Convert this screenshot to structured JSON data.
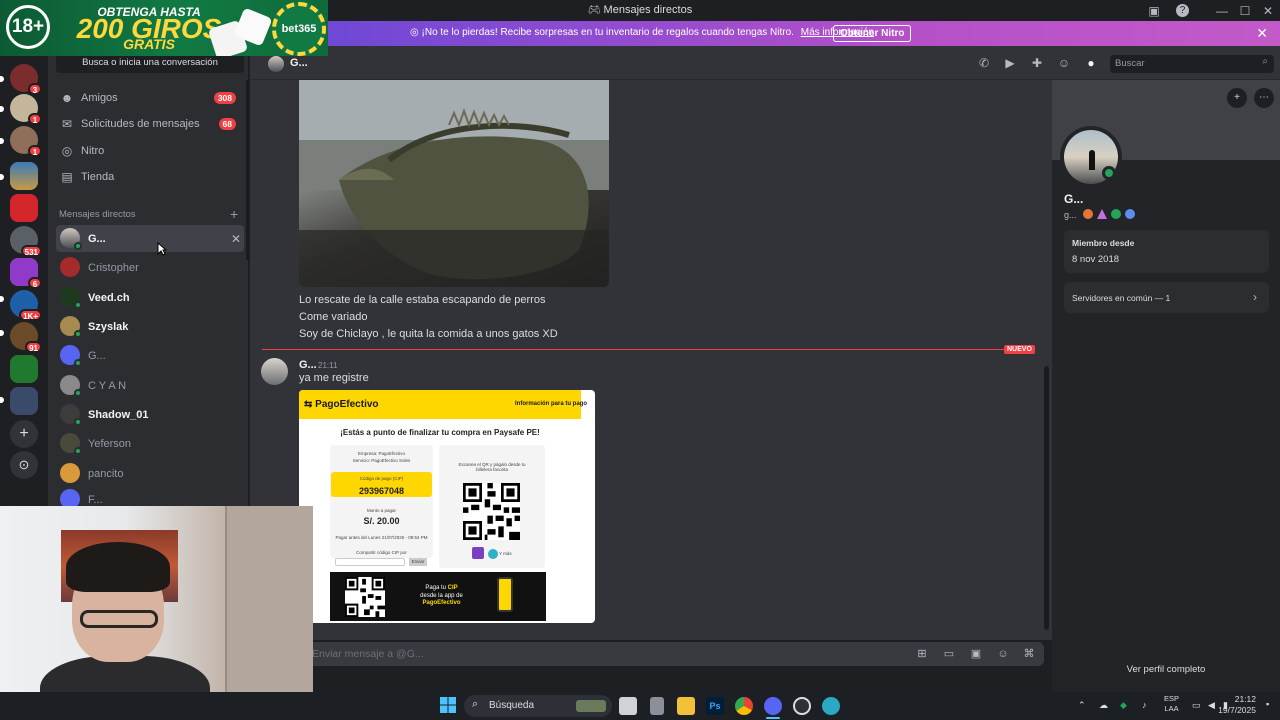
{
  "window": {
    "title": "Mensajes directos",
    "minimize": "—",
    "maximize": "☐",
    "close": "✕"
  },
  "ad": {
    "age": "18+",
    "line1": "OBTENGA HASTA",
    "line2": "200 GIROS",
    "line3": "GRATIS",
    "brand": "bet365"
  },
  "banner": {
    "text": "¡No te lo pierdas! Recibe sorpresas en tu inventario de regalos cuando tengas Nitro.",
    "link": "Más información",
    "cta": "Obtener Nitro",
    "close": "✕"
  },
  "rail": {
    "badges": [
      "3",
      "1",
      "1",
      "",
      "",
      "531",
      "6",
      "1K+",
      "91",
      "",
      ""
    ]
  },
  "sidebar": {
    "search_placeholder": "Busca o inicia una conversación",
    "nav": [
      {
        "label": "Amigos",
        "count": "308"
      },
      {
        "label": "Solicitudes de mensajes",
        "count": "68"
      },
      {
        "label": "Nitro",
        "count": ""
      },
      {
        "label": "Tienda",
        "count": ""
      }
    ],
    "dm_header": "Mensajes directos",
    "dm_add": "+",
    "dms": [
      {
        "name": "G...",
        "bold": true
      },
      {
        "name": "Cristopher",
        "bold": false
      },
      {
        "name": "Veed.ch",
        "bold": true
      },
      {
        "name": "Szyslak",
        "bold": true
      },
      {
        "name": "G...",
        "bold": false
      },
      {
        "name": "C Y A N",
        "bold": false
      },
      {
        "name": "Shadow_01",
        "bold": true
      },
      {
        "name": "Yeferson",
        "bold": false
      },
      {
        "name": "pancito",
        "bold": false
      },
      {
        "name": "F...",
        "bold": false
      }
    ],
    "dm_close": "✕"
  },
  "chat": {
    "header_name": "G...",
    "search_placeholder": "Buscar",
    "messages_prev": [
      "Lo rescate de la calle estaba escapando de perros",
      "Come variado",
      "Soy de Chiclayo , le quita la comida a unos gatos XD"
    ],
    "new_label": "NUEVO",
    "author": "G...",
    "time": "21:11",
    "message": "ya me registre",
    "input_placeholder": "Enviar mensaje a @G..."
  },
  "receipt": {
    "brand": "PagoEfectivo",
    "info": "Información para tu pago",
    "heading": "¡Estás a punto de finalizar tu compra en Paysafe PE!",
    "company": "Empresa: PagoEfectivo",
    "service": "Servicio: PagoEfectivo Soles",
    "cip_label": "Código de pago (CIP)",
    "cip": "293967048",
    "amount_label": "Monto a pagar",
    "amount": "S/. 20.00",
    "due": "Pagar antes del Lunes 21/07/2025 - 08:54 PM",
    "share": "Compartir código CIP por",
    "send": "Enviar",
    "scan_text": "Escanea el QR y págalo desde tu billetera favorita",
    "yape": "Y más",
    "bottom_line1": "Paga tu",
    "bottom_cip": "CIP",
    "bottom_line2": "desde la app de",
    "bottom_brand": "PagoEfectivo"
  },
  "profile": {
    "name": "G...",
    "username": "g...",
    "member_since_label": "Miembro desde",
    "member_since": "8 nov 2018",
    "common_servers": "Servidores en común — 1",
    "full_profile": "Ver perfil completo"
  },
  "taskbar": {
    "search": "Búsqueda",
    "lang_top": "ESP",
    "lang_bottom": "LAA",
    "time": "21:12",
    "date": "19/7/2025"
  },
  "colors": {
    "accent_red": "#f23f43",
    "online_green": "#23a55a",
    "nitro_gradient_start": "#6f48d6",
    "pagoefectivo_yellow": "#ffd700"
  }
}
